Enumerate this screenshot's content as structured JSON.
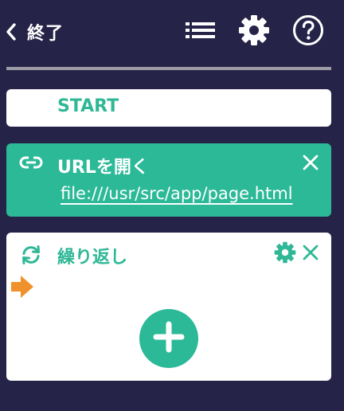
{
  "header": {
    "back_label": "終了"
  },
  "blocks": {
    "start": {
      "label": "START"
    },
    "open_url": {
      "title": "URLを開く",
      "url": "file:///usr/src/app/page.html"
    },
    "loop": {
      "title": "繰り返し"
    }
  },
  "icons": {
    "back": "chevron-left-icon",
    "list": "list-icon",
    "settings": "gear-icon",
    "help": "help-circle-icon",
    "link": "link-icon",
    "close": "close-icon",
    "loop": "sync-icon",
    "loop_settings": "gear-icon",
    "pointer": "arrow-right-icon",
    "add": "plus-icon"
  },
  "colors": {
    "background": "#262348",
    "accent": "#2bb998",
    "card": "#ffffff",
    "pointer": "#f0922b",
    "divider": "#9d9ba6"
  }
}
